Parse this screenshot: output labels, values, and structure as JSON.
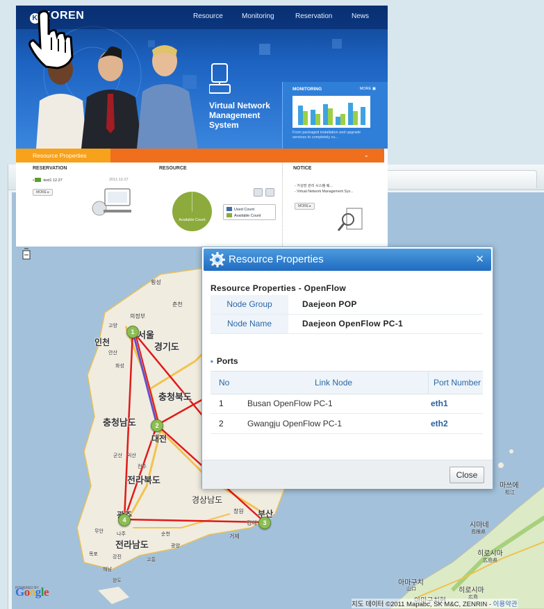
{
  "site": {
    "logo_text": "KOREN",
    "nav": [
      "Resource",
      "Monitoring",
      "Reservation",
      "News"
    ],
    "hero_title_lines": [
      "Virtual Network",
      "Management",
      "System"
    ],
    "monitoring": {
      "heading": "MONITORING",
      "more": "MORE",
      "description": "From packaged installation and upgrade services to completely cu..."
    },
    "tab_label": "Resource Properties",
    "reservation": {
      "heading": "RESERVATION",
      "item_label": "test1 12.27",
      "item_date": "2011-12-27",
      "more": "MORE"
    },
    "resource": {
      "heading": "RESOURCE",
      "pie_label": "Available Count",
      "legend": [
        {
          "label": "Used Count",
          "color": "#3e6ea8"
        },
        {
          "label": "Available Count",
          "color": "#8cab3c"
        }
      ]
    },
    "notice": {
      "heading": "NOTICE",
      "items": [
        "- 가상망 관리 시스템 웨...",
        "- Virtual Network Management Sys..."
      ],
      "more": "MORE"
    }
  },
  "map": {
    "labels": [
      {
        "text": "인천",
        "key": "incheon"
      },
      {
        "text": "서울",
        "key": "seoul"
      },
      {
        "text": "경기도",
        "key": "gyeonggi"
      },
      {
        "text": "충청북도",
        "key": "chungbuk"
      },
      {
        "text": "충청남도",
        "key": "chungnam"
      },
      {
        "text": "대전",
        "key": "daejeon"
      },
      {
        "text": "전라북도",
        "key": "jeonbuk"
      },
      {
        "text": "광주",
        "key": "gwangju"
      },
      {
        "text": "전라남도",
        "key": "jeonnam"
      },
      {
        "text": "경상남도",
        "key": "gyeongnam"
      },
      {
        "text": "부산",
        "key": "busan"
      },
      {
        "text": "의정부",
        "key": "uijeongbu"
      },
      {
        "text": "횡성",
        "key": "hoengseong"
      },
      {
        "text": "춘천",
        "key": "chuncheon"
      },
      {
        "text": "고양",
        "key": "goyang"
      },
      {
        "text": "안산",
        "key": "ansan"
      },
      {
        "text": "화성",
        "key": "hwaseong"
      },
      {
        "text": "군산",
        "key": "gunsan"
      },
      {
        "text": "익산",
        "key": "iksan"
      },
      {
        "text": "전주",
        "key": "jeonju"
      },
      {
        "text": "무안",
        "key": "muan"
      },
      {
        "text": "나주",
        "key": "naju"
      },
      {
        "text": "목포",
        "key": "mokpo"
      },
      {
        "text": "강진",
        "key": "gangjin"
      },
      {
        "text": "해남",
        "key": "haenam"
      },
      {
        "text": "완도",
        "key": "wando"
      },
      {
        "text": "고흥",
        "key": "goheung"
      },
      {
        "text": "순천",
        "key": "suncheon"
      },
      {
        "text": "광양",
        "key": "gwangyang"
      },
      {
        "text": "창원",
        "key": "changwon"
      },
      {
        "text": "김해",
        "key": "gimhae"
      },
      {
        "text": "거제",
        "key": "geoje"
      },
      {
        "text": "마쓰에",
        "key": "matsue"
      },
      {
        "text": "松江",
        "key": "matsue_kanji"
      },
      {
        "text": "시마네",
        "key": "shimane"
      },
      {
        "text": "島根県",
        "key": "shimane_kanji"
      },
      {
        "text": "히로시마",
        "key": "hiroshima"
      },
      {
        "text": "広島県",
        "key": "hiroshima_kanji"
      },
      {
        "text": "아마구치",
        "key": "yamaguchi"
      },
      {
        "text": "山口",
        "key": "yamaguchi_kanji"
      },
      {
        "text": "히로시마",
        "key": "hiroshima_city"
      },
      {
        "text": "広島",
        "key": "hiroshima_city_kanji"
      },
      {
        "text": "아마구치현",
        "key": "yamaguchi_pref"
      }
    ],
    "markers": [
      "1",
      "2",
      "3",
      "4"
    ],
    "powered_by": "POWERED BY",
    "google": "Google",
    "copyright": "지도 데이터 ©2011 Mapabc, SK M&C, ZENRIN - ",
    "terms": "이용약관"
  },
  "dialog": {
    "title": "Resource Properties",
    "subtitle": "Resource Properties - OpenFlow",
    "properties": [
      {
        "key": "Node Group",
        "value": "Daejeon POP"
      },
      {
        "key": "Node Name",
        "value": "Daejeon OpenFlow PC-1"
      }
    ],
    "ports_heading": "Ports",
    "ports_columns": [
      "No",
      "Link Node",
      "Port Number"
    ],
    "ports": [
      {
        "no": "1",
        "link_node": "Busan OpenFlow PC-1",
        "port": "eth1"
      },
      {
        "no": "2",
        "link_node": "Gwangju OpenFlow PC-1",
        "port": "eth2"
      }
    ],
    "close_label": "Close"
  },
  "colors": {
    "orange": "#ef6f1d",
    "orange_tab": "#f8a11a",
    "dialog_header": "#1f6cc2",
    "link_red": "#e01919",
    "link_purple": "#6a4fc8",
    "marker_green": "#8dbd54"
  }
}
